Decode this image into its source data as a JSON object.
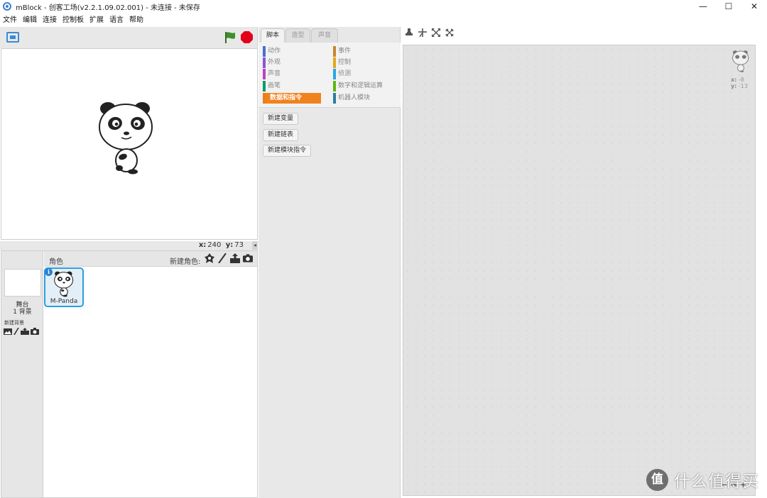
{
  "window": {
    "title": "mBlock - 创客工场(v2.2.1.09.02.001) - 未连接 - 未保存",
    "controls": [
      "—",
      "☐",
      "✕"
    ]
  },
  "menu": [
    "文件",
    "编辑",
    "连接",
    "控制板",
    "扩展",
    "语言",
    "帮助"
  ],
  "stage": {
    "coords": {
      "x_label": "x:",
      "x_value": "240",
      "y_label": "y:",
      "y_value": "73"
    }
  },
  "sprites": {
    "header_title": "角色",
    "new_sprite_label": "新建角色:",
    "stage_item": {
      "name": "舞台",
      "count": "1 背景",
      "new_backdrop_label": "新建背景"
    },
    "items": [
      {
        "name": "M-Panda"
      }
    ],
    "info_label": "i"
  },
  "tabs": [
    "脚本",
    "造型",
    "声音"
  ],
  "categories": [
    {
      "label": "动作",
      "color": "#4a6cd4"
    },
    {
      "label": "事件",
      "color": "#c88330"
    },
    {
      "label": "外观",
      "color": "#8a55d7"
    },
    {
      "label": "控制",
      "color": "#e1a91a"
    },
    {
      "label": "声音",
      "color": "#bb42c3"
    },
    {
      "label": "侦测",
      "color": "#2ca5e2"
    },
    {
      "label": "画笔",
      "color": "#0e9a6c"
    },
    {
      "label": "数字和逻辑运算",
      "color": "#5cb712"
    },
    {
      "label": "数据和指令",
      "color": "#ee7d16",
      "active": true
    },
    {
      "label": "机器人模块",
      "color": "#2a7f9e"
    }
  ],
  "data_buttons": [
    "新建变量",
    "新建链表",
    "新建模块指令"
  ],
  "script_area": {
    "x_label": "x:",
    "x_value": "-8",
    "y_label": "y:",
    "y_value": "-13",
    "zoom_controls": [
      "−",
      "=",
      "+"
    ]
  },
  "watermark": {
    "logo": "值",
    "text": "什么值得买"
  },
  "colors": {
    "accent": "#2a9fdc",
    "active_category": "#f0821e",
    "flag": "#3c8f2a",
    "stop": "#e3001b"
  }
}
